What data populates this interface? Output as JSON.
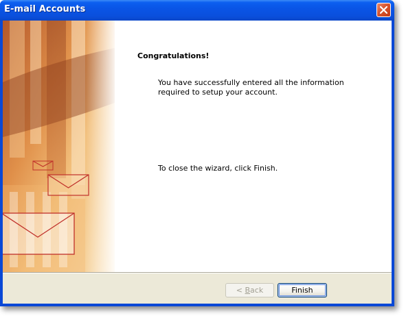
{
  "window": {
    "title": "E-mail Accounts"
  },
  "content": {
    "heading": "Congratulations!",
    "message": "You have successfully entered all the information required to setup your account.",
    "close_hint": "To close the wizard, click Finish."
  },
  "buttons": {
    "back_prefix": "< ",
    "back_hotkey": "B",
    "back_rest": "ack",
    "finish": "Finish"
  },
  "icons": {
    "close": "close-icon",
    "banner": "envelope-icon"
  }
}
